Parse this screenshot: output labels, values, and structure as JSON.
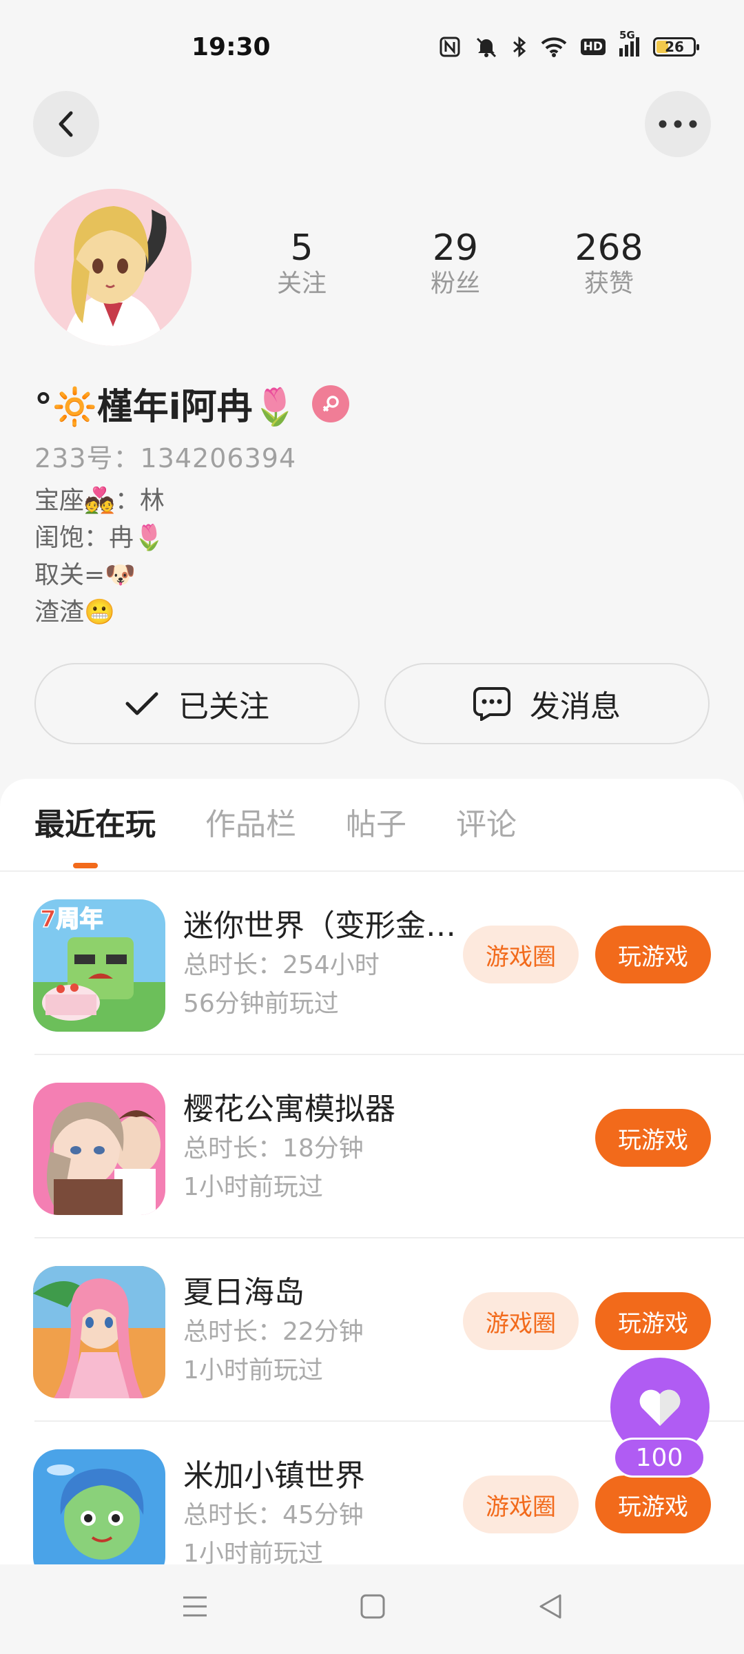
{
  "status_bar": {
    "time": "19:30",
    "battery": "26",
    "network_label": "5G",
    "hd_label": "HD",
    "icons": [
      "nfc-icon",
      "mute-icon",
      "bluetooth-icon",
      "wifi-icon",
      "hd-icon",
      "signal-icon",
      "battery-icon"
    ]
  },
  "header": {
    "back_icon": "back-icon",
    "more_icon": "more-icon"
  },
  "profile": {
    "stats": [
      {
        "value": "5",
        "label": "关注"
      },
      {
        "value": "29",
        "label": "粉丝"
      },
      {
        "value": "268",
        "label": "获赞"
      }
    ],
    "name": "°🔆槿年i阿冉🌷",
    "gender_icon": "female-icon",
    "uid": "233号：134206394",
    "bio": [
      "宝座💑：林",
      "闺饱：冉🌷",
      "取关=🐶",
      "渣渣😬"
    ]
  },
  "actions": {
    "follow_label": "已关注",
    "message_label": "发消息"
  },
  "tabs": [
    "最近在玩",
    "作品栏",
    "帖子",
    "评论"
  ],
  "games": [
    {
      "title": "迷你世界（变形金刚…",
      "duration": "总时长：254小时",
      "last": "56分钟前玩过",
      "circle": true,
      "circle_label": "游戏圈",
      "play_label": "玩游戏",
      "icon_badge": "7周年"
    },
    {
      "title": "樱花公寓模拟器",
      "duration": "总时长：18分钟",
      "last": "1小时前玩过",
      "circle": false,
      "play_label": "玩游戏"
    },
    {
      "title": "夏日海岛",
      "duration": "总时长：22分钟",
      "last": "1小时前玩过",
      "circle": true,
      "circle_label": "游戏圈",
      "play_label": "玩游戏"
    },
    {
      "title": "米加小镇世界",
      "duration": "总时长：45分钟",
      "last": "1小时前玩过",
      "circle": true,
      "circle_label": "游戏圈",
      "play_label": "玩游戏"
    }
  ],
  "float_like": {
    "count": "100",
    "icon": "heart-icon"
  },
  "colors": {
    "accent": "#f26a1b",
    "like": "#b05cf3"
  }
}
